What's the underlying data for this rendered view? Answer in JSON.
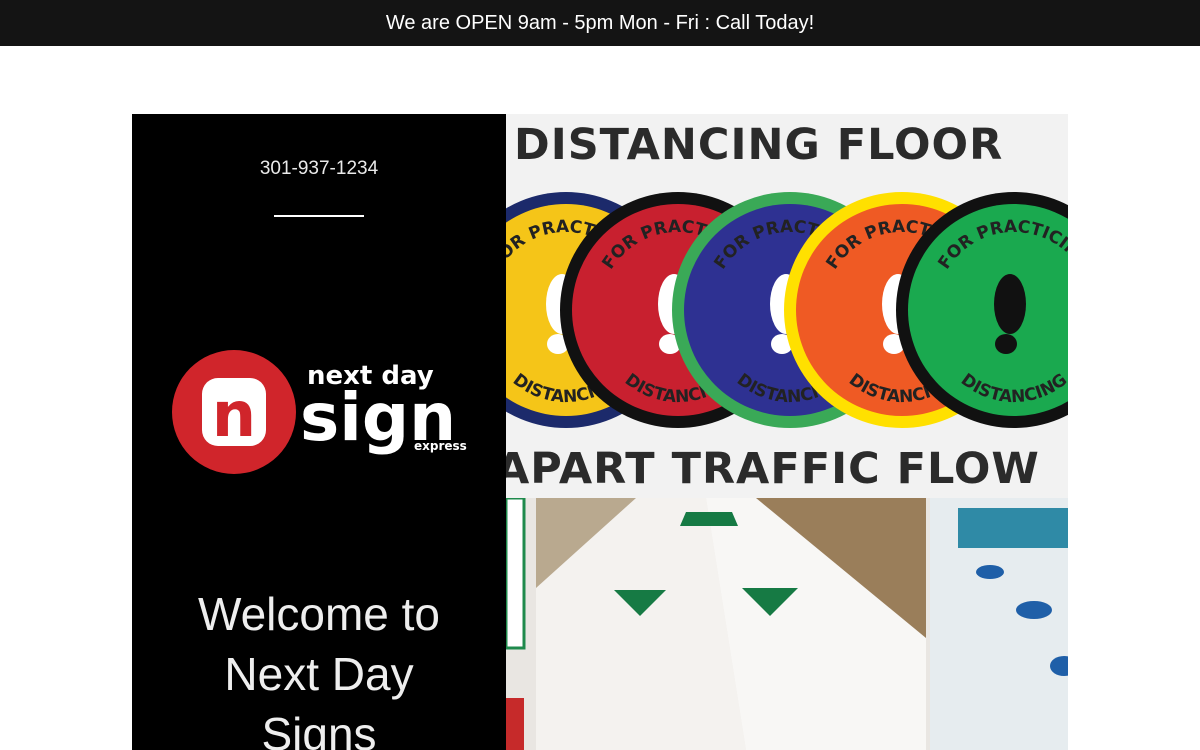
{
  "announcement": {
    "text": "We are OPEN 9am - 5pm Mon - Fri : Call Today!"
  },
  "contact": {
    "phone": "301-937-1234"
  },
  "logo": {
    "line1": "next day",
    "line2": "sign",
    "line3": "express",
    "icon_letter": "n",
    "brand_color": "#d0252b"
  },
  "hero": {
    "welcome_line1": "Welcome to",
    "welcome_line2": "Next Day",
    "welcome_line3": "Signs",
    "image": {
      "headline_top": "DISTANCING FLOOR",
      "headline_mid": "APART TRAFFIC FLOW",
      "sticker_text_top": "FOR PRACTICING",
      "sticker_text_bottom": "DISTANCING",
      "sticker_colors": [
        "#f5c518",
        "#c8202f",
        "#2e3192",
        "#ef5a24",
        "#1aa94f"
      ]
    }
  },
  "colors": {
    "topbar": "#141414",
    "panel": "#000000"
  }
}
